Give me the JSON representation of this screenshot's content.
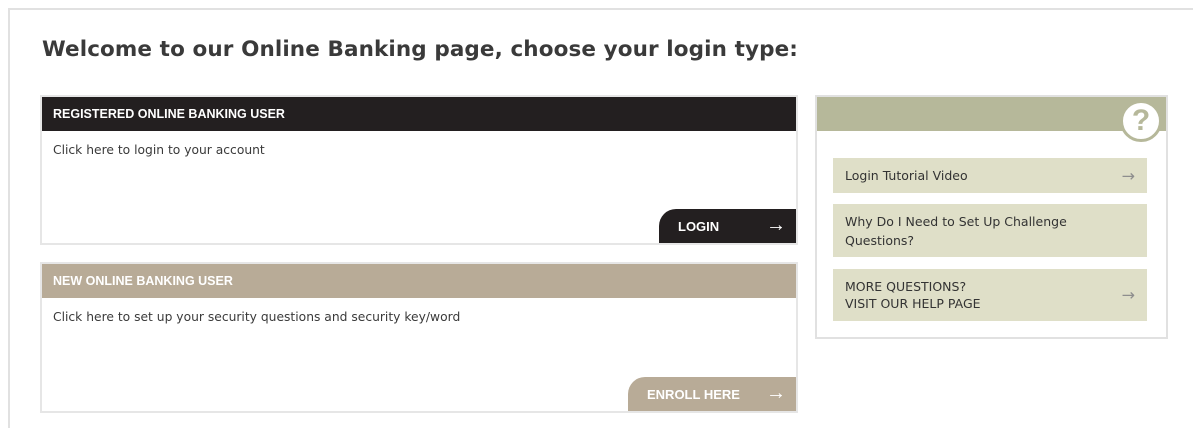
{
  "page": {
    "title": "Welcome to our Online Banking page, choose your login type:"
  },
  "registered": {
    "header": "REGISTERED ONLINE BANKING USER",
    "description": "Click here to login to your account",
    "button_label": "LOGIN",
    "button_arrow": "→"
  },
  "new_user": {
    "header": "NEW ONLINE BANKING USER",
    "description": "Click here to set up your security questions and security key/word",
    "button_label": "ENROLL HERE",
    "button_arrow": "→"
  },
  "help": {
    "icon_glyph": "?",
    "links": [
      {
        "line1": "Login Tutorial Video",
        "line2": "",
        "arrow": "→"
      },
      {
        "line1": "Why Do I Need to Set Up Challenge",
        "line2": "Questions?",
        "arrow": ""
      },
      {
        "line1": "MORE QUESTIONS?",
        "line2": "VISIT OUR HELP PAGE",
        "arrow": "→"
      }
    ]
  },
  "colors": {
    "registered_header": "#231f20",
    "new_user_header": "#b8ab97",
    "help_header": "#b6b89a",
    "help_link_bg": "#dfdfc8"
  }
}
